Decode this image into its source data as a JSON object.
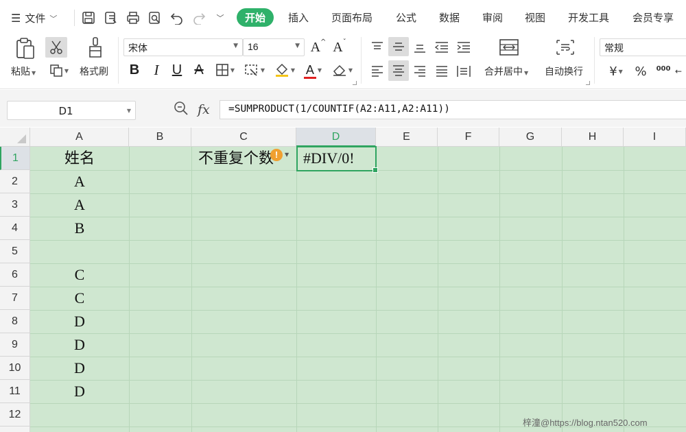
{
  "menu": {
    "file_label": "文件",
    "tabs": [
      "开始",
      "插入",
      "页面布局",
      "公式",
      "数据",
      "审阅",
      "视图",
      "开发工具",
      "会员专享"
    ]
  },
  "ribbon": {
    "paste_label": "粘贴",
    "format_painter_label": "格式刷",
    "font_name": "宋体",
    "font_size": "16",
    "bold_glyph": "B",
    "italic_glyph": "I",
    "underline_glyph": "U",
    "strike_glyph": "A",
    "font_color_glyph": "A",
    "font_grow_glyph": "A",
    "font_shrink_glyph": "A",
    "merge_center_label": "合并居中",
    "wrap_text_label": "自动换行",
    "number_format": "常规",
    "currency_glyph": "¥",
    "percent_glyph": "%",
    "thousands_glyph": "000",
    "accent_green": "#2fb16a",
    "font_color_red": "#e02020"
  },
  "formula_bar": {
    "name_box": "D1",
    "fx_label": "fx",
    "formula": "=SUMPRODUCT(1/COUNTIF(A2:A11,A2:A11))"
  },
  "sheet": {
    "columns": [
      "A",
      "B",
      "C",
      "D",
      "E",
      "F",
      "G",
      "H",
      "I"
    ],
    "active_column": "D",
    "rows": [
      "1",
      "2",
      "3",
      "4",
      "5",
      "6",
      "7",
      "8",
      "9",
      "10",
      "11",
      "12"
    ],
    "active_row": "1",
    "cells": {
      "A1": "姓名",
      "C1": "不重复个数",
      "D1": "#DIV/0!",
      "A2": "A",
      "A3": "A",
      "A4": "B",
      "A6": "C",
      "A7": "C",
      "A8": "D",
      "A9": "D",
      "A10": "D",
      "A11": "D"
    },
    "warning_glyph": "!"
  },
  "watermark": "梓潼@https://blog.ntan520.com"
}
